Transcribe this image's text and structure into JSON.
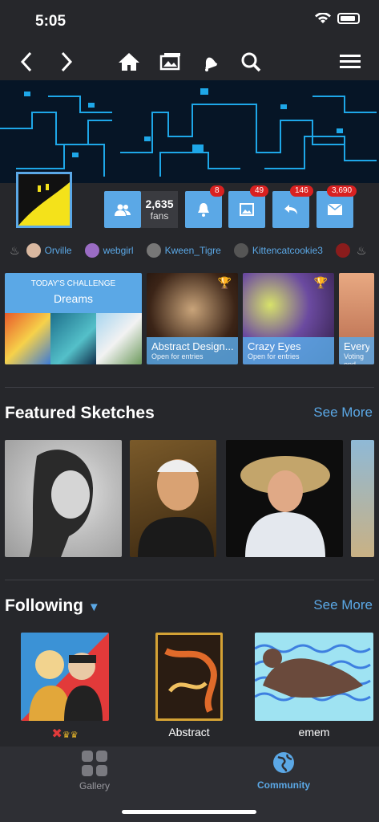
{
  "status": {
    "time": "5:05"
  },
  "nav": {
    "back": "chevron-left-icon",
    "forward": "chevron-right-icon",
    "home": "home-icon",
    "gallery": "gallery-icon",
    "notifications": "bell-icon",
    "search": "search-icon",
    "menu": "menu-icon"
  },
  "profile": {
    "fans_count": "2,635",
    "fans_label": "fans"
  },
  "badges": {
    "notifications": "8",
    "images": "49",
    "replies": "146",
    "messages": "3,690"
  },
  "online_users": [
    {
      "name": "Orville"
    },
    {
      "name": "webgirl"
    },
    {
      "name": "Kween_Tigre"
    },
    {
      "name": "Kittencatcookie3"
    }
  ],
  "challenges": [
    {
      "kicker": "TODAY'S CHALLENGE",
      "title": "Dreams"
    },
    {
      "title": "Abstract Design...",
      "status": "Open for entries"
    },
    {
      "title": "Crazy Eyes",
      "status": "Open for entries"
    },
    {
      "title": "Everyd",
      "status": "Voting end"
    }
  ],
  "featured": {
    "title": "Featured Sketches",
    "see_more": "See More"
  },
  "following": {
    "title": "Following",
    "see_more": "See More",
    "items": [
      {
        "name": ""
      },
      {
        "name": "Abstract"
      },
      {
        "name": "emem"
      }
    ]
  },
  "tabs": {
    "gallery": "Gallery",
    "community": "Community"
  },
  "colors": {
    "accent": "#5ba8e6",
    "bg": "#26272b",
    "badge": "#d92121"
  }
}
